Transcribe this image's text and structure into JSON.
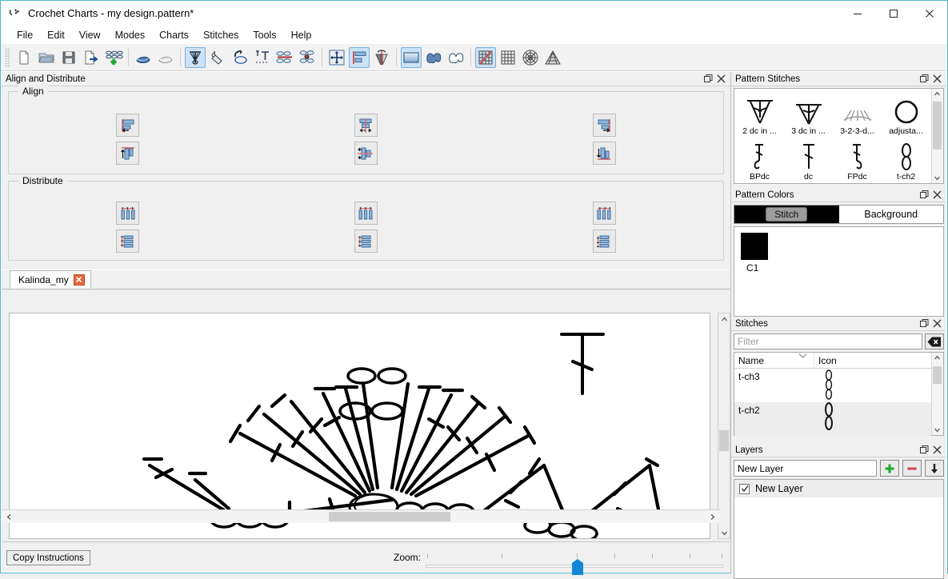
{
  "window": {
    "title": "Crochet Charts - my design.pattern*",
    "app_icon": "crochet-hook-icon",
    "controls": {
      "minimize": "minimize-icon",
      "maximize": "maximize-icon",
      "close": "close-icon"
    }
  },
  "menubar": {
    "items": [
      {
        "label": "File"
      },
      {
        "label": "Edit"
      },
      {
        "label": "View"
      },
      {
        "label": "Modes"
      },
      {
        "label": "Charts"
      },
      {
        "label": "Stitches"
      },
      {
        "label": "Tools"
      },
      {
        "label": "Help"
      }
    ]
  },
  "toolbar": {
    "groups": [
      {
        "buttons": [
          {
            "name": "new-document-button",
            "icon": "new-document-icon",
            "active": false
          },
          {
            "name": "open-file-button",
            "icon": "open-folder-icon",
            "active": false
          },
          {
            "name": "save-button",
            "icon": "floppy-disk-icon",
            "active": false
          },
          {
            "name": "export-button",
            "icon": "export-page-icon",
            "active": false
          },
          {
            "name": "add-chart-button",
            "icon": "add-chart-icon",
            "active": false
          }
        ]
      },
      {
        "buttons": [
          {
            "name": "undo-button",
            "icon": "undo-arrow-icon",
            "active": false
          },
          {
            "name": "redo-button",
            "icon": "redo-arrow-icon",
            "active": false
          }
        ]
      },
      {
        "buttons": [
          {
            "name": "stitch-tool-button",
            "icon": "fan-stitch-icon",
            "active": true
          },
          {
            "name": "color-fill-tool-button",
            "icon": "paint-bucket-icon",
            "active": false
          },
          {
            "name": "rotate-tool-button",
            "icon": "rotate-loop-icon",
            "active": false
          },
          {
            "name": "insert-text-button",
            "icon": "text-insert-icon",
            "active": false
          },
          {
            "name": "chain-tool-button",
            "icon": "chain-loops-icon",
            "active": false
          },
          {
            "name": "chain-marker-button",
            "icon": "chain-marker-icon",
            "active": false
          }
        ]
      },
      {
        "buttons": [
          {
            "name": "move-tool-button",
            "icon": "move-arrows-icon",
            "active": false
          },
          {
            "name": "align-panel-button",
            "icon": "align-left-icon",
            "active": true
          },
          {
            "name": "mirror-tool-button",
            "icon": "mirror-flip-icon",
            "active": false
          }
        ]
      },
      {
        "buttons": [
          {
            "name": "rectangle-chart-button",
            "icon": "rectangle-gradient-icon",
            "active": true
          },
          {
            "name": "blob-filled-button",
            "icon": "blob-filled-icon",
            "active": false
          },
          {
            "name": "blob-outline-button",
            "icon": "blob-outline-icon",
            "active": false
          }
        ]
      },
      {
        "buttons": [
          {
            "name": "grid-off-button",
            "icon": "grid-crossed-icon",
            "active": true
          },
          {
            "name": "grid-on-button",
            "icon": "grid-icon",
            "active": false
          },
          {
            "name": "round-chart-button",
            "icon": "round-grid-icon",
            "active": false
          },
          {
            "name": "triangle-chart-button",
            "icon": "triangle-grid-icon",
            "active": false
          }
        ]
      }
    ]
  },
  "align_dock": {
    "title": "Align and Distribute",
    "float_icon": "float-panel-icon",
    "close_icon": "close-icon",
    "align": {
      "legend": "Align",
      "buttons": [
        {
          "name": "align-left-button",
          "icon": "align-left-icon"
        },
        {
          "name": "align-center-horizontal-button",
          "icon": "align-center-h-icon"
        },
        {
          "name": "align-right-button",
          "icon": "align-right-icon"
        },
        {
          "name": "align-top-button",
          "icon": "align-top-icon"
        },
        {
          "name": "align-center-vertical-button",
          "icon": "align-center-v-icon"
        },
        {
          "name": "align-bottom-button",
          "icon": "align-bottom-icon"
        }
      ]
    },
    "distribute": {
      "legend": "Distribute",
      "buttons": [
        {
          "name": "distribute-left-button",
          "icon": "distribute-h-left-icon"
        },
        {
          "name": "distribute-center-h-button",
          "icon": "distribute-h-center-icon"
        },
        {
          "name": "distribute-right-button",
          "icon": "distribute-h-right-icon"
        },
        {
          "name": "distribute-top-button",
          "icon": "distribute-v-top-icon"
        },
        {
          "name": "distribute-center-v-button",
          "icon": "distribute-v-center-icon"
        },
        {
          "name": "distribute-bottom-button",
          "icon": "distribute-v-bottom-icon"
        }
      ]
    }
  },
  "canvas": {
    "tab": {
      "label": "Kalinda_my",
      "close_icon": "close-icon"
    },
    "content_description": "crochet fan shell chart",
    "scroll": {
      "up_icon": "chevron-up-icon",
      "down_icon": "chevron-down-icon",
      "left_icon": "chevron-left-icon",
      "right_icon": "chevron-right-icon"
    }
  },
  "statusbar": {
    "copy_instructions": "Copy Instructions",
    "zoom_label": "Zoom:"
  },
  "pattern_stitches": {
    "title": "Pattern Stitches",
    "float_icon": "float-panel-icon",
    "close_icon": "close-icon",
    "items": [
      {
        "label": "2 dc in ...",
        "icon": "2-dc-cluster-icon"
      },
      {
        "label": "3 dc in ...",
        "icon": "3-dc-cluster-icon"
      },
      {
        "label": "3-2-3-d...",
        "icon": "shell-fan-icon"
      },
      {
        "label": "adjusta...",
        "icon": "adjustable-ring-icon"
      },
      {
        "label": "BPdc",
        "icon": "back-post-dc-icon"
      },
      {
        "label": "dc",
        "icon": "double-crochet-icon"
      },
      {
        "label": "FPdc",
        "icon": "front-post-dc-icon"
      },
      {
        "label": "t-ch2",
        "icon": "turning-chain-2-icon"
      }
    ]
  },
  "pattern_colors": {
    "title": "Pattern Colors",
    "float_icon": "float-panel-icon",
    "close_icon": "close-icon",
    "tabs": [
      {
        "label": "Stitch",
        "selected": true
      },
      {
        "label": "Background",
        "selected": false
      }
    ],
    "swatches": [
      {
        "name": "C1",
        "color": "#000000"
      }
    ]
  },
  "stitches_panel": {
    "title": "Stitches",
    "float_icon": "float-panel-icon",
    "close_icon": "close-icon",
    "filter_placeholder": "Filter",
    "filter_value": "",
    "clear_icon": "clear-filter-icon",
    "columns": [
      "Name",
      "Icon"
    ],
    "rows": [
      {
        "name": "t-ch3",
        "icon": "turning-chain-3-icon",
        "selected": false
      },
      {
        "name": "t-ch2",
        "icon": "turning-chain-2-icon",
        "selected": true
      }
    ]
  },
  "layers": {
    "title": "Layers",
    "float_icon": "float-panel-icon",
    "close_icon": "close-icon",
    "input_value": "New Layer",
    "add_icon": "plus-icon",
    "remove_icon": "minus-icon",
    "move_down_icon": "arrow-down-icon",
    "items": [
      {
        "label": "New Layer",
        "checked": true
      }
    ]
  },
  "colors": {
    "accent": "#4fb8c9",
    "panel": "#f0f0f0",
    "active_tool": "#cbe3f7",
    "slider": "#1287d6",
    "tab_close": "#e8663a"
  }
}
